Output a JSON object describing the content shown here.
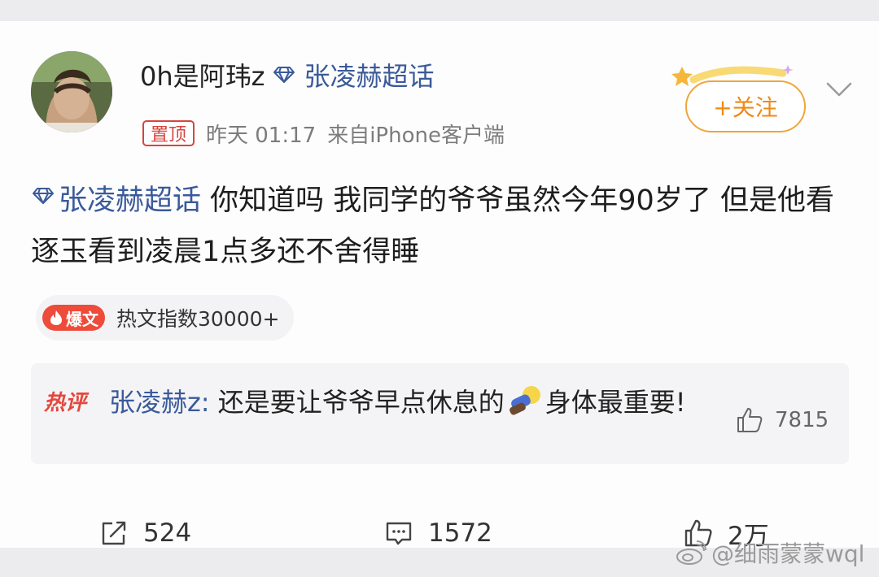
{
  "post": {
    "username": "0h是阿玮z",
    "supertopic": "张凌赫超话",
    "pin_label": "置顶",
    "time": "昨天 01:17",
    "source": "来自iPhone客户端",
    "follow_label": "+关注",
    "topic": "张凌赫超话",
    "text": "你知道吗 我同学的爷爷虽然今年90岁了 但是他看逐玉看到凌晨1点多还不舍得睡"
  },
  "hot_badge": {
    "tag": "爆文",
    "text": "热文指数30000+"
  },
  "hot_comment": {
    "tag": "热评",
    "commenter": "张凌赫z:",
    "text_before_emoji": "还是要让爷爷早点休息的",
    "text_after_emoji": "身体最重要!",
    "likes": "7815"
  },
  "actions": {
    "reposts": "524",
    "comments": "1572",
    "likes": "2万"
  },
  "watermark": "@细雨蒙蒙wql",
  "colors": {
    "link": "#3a5a9a",
    "accent_red": "#e4473f",
    "follow_orange": "#ef8a17"
  }
}
